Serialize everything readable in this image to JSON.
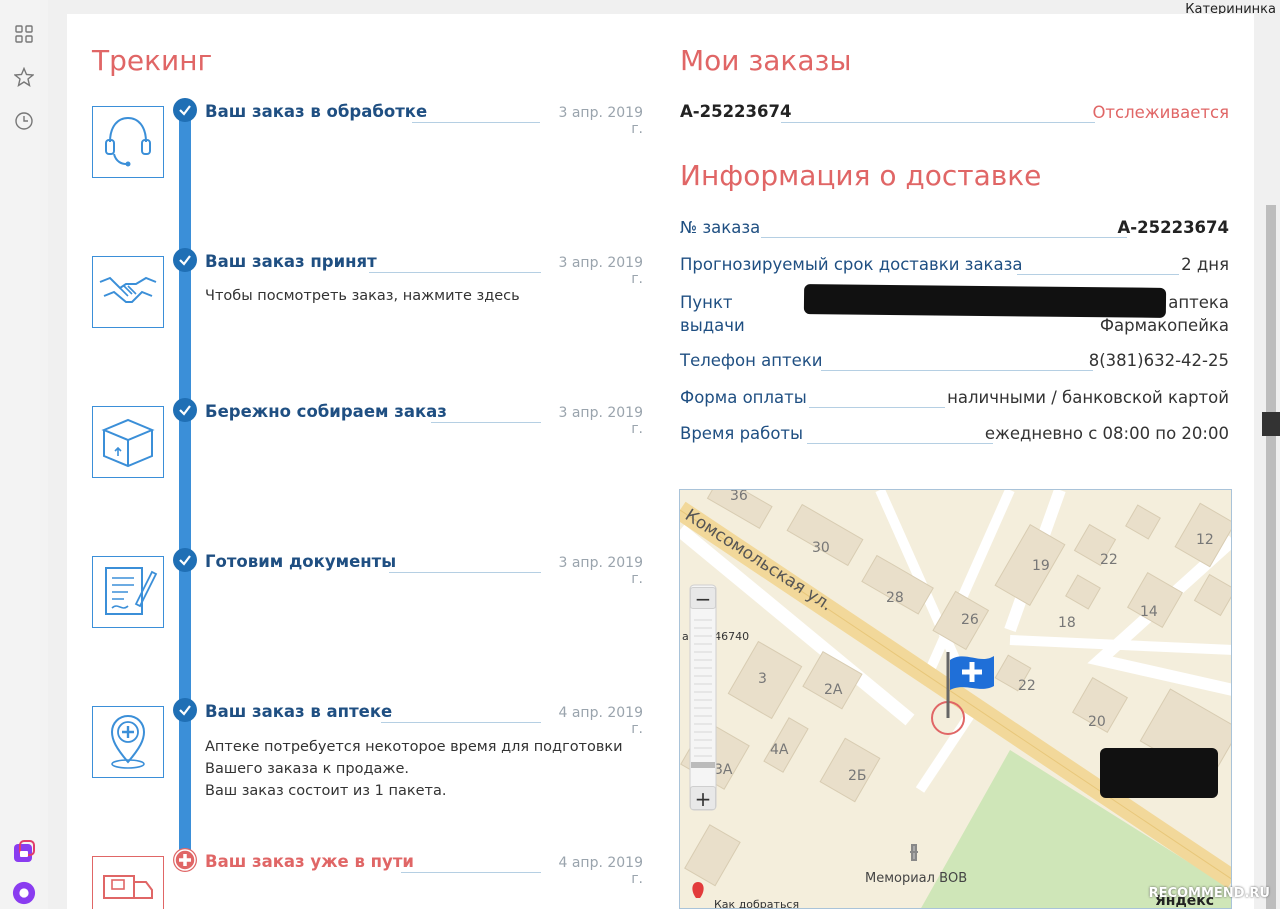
{
  "browser": {
    "user_name": "Катерининка",
    "left_icons": [
      "grid-icon",
      "star-icon",
      "clock-icon",
      "app-icon",
      "alice-icon"
    ]
  },
  "tracking": {
    "title": "Трекинг",
    "steps": [
      {
        "icon": "headset-icon",
        "status": "done",
        "title": "Ваш заказ в обработке",
        "date": "3 апр. 2019 г.",
        "desc": []
      },
      {
        "icon": "handshake-icon",
        "status": "done",
        "title": "Ваш заказ принят",
        "date": "3 апр. 2019 г.",
        "desc": [
          "Чтобы посмотреть заказ, нажмите здесь"
        ]
      },
      {
        "icon": "box-icon",
        "status": "done",
        "title": "Бережно собираем заказ",
        "date": "3 апр. 2019 г.",
        "desc": []
      },
      {
        "icon": "document-icon",
        "status": "done",
        "title": "Готовим документы",
        "date": "3 апр. 2019 г.",
        "desc": []
      },
      {
        "icon": "pharmacy-pin-icon",
        "status": "done",
        "title": "Ваш заказ в аптеке",
        "date": "4 апр. 2019 г.",
        "desc": [
          "Аптеке потребуется некоторое время для подготовки",
          "Вашего заказа к продаже.",
          "Ваш заказ состоит из 1 пакета."
        ]
      },
      {
        "icon": "truck-icon",
        "status": "current",
        "title": "Ваш заказ уже в пути",
        "date": "4 апр. 2019 г.",
        "desc": []
      }
    ]
  },
  "orders": {
    "title": "Мои заказы",
    "order_number": "А-25223674",
    "order_status": "Отслеживается"
  },
  "delivery": {
    "title": "Информация о доставке",
    "rows": [
      {
        "label": "№ заказа",
        "value": "А-25223674"
      },
      {
        "label": "Прогнозируемый срок доставки заказа",
        "value": "2 дня"
      },
      {
        "label": "Пункт выдачи",
        "value": "аптека Фармакопейка"
      },
      {
        "label": "Телефон аптеки",
        "value": "8(381)632-42-25"
      },
      {
        "label": "Форма оплаты",
        "value": "наличными / банковской картой"
      },
      {
        "label": "Время работы",
        "value": "ежедневно с 08:00 по 20:00"
      }
    ],
    "pickup_label_line1": "Пункт",
    "pickup_label_line2": "выдачи",
    "pickup_value_line1": "аптека",
    "pickup_value_line2": "Фармакопейка"
  },
  "map": {
    "street": "Комсомольская ул.",
    "buildings": [
      "36",
      "30",
      "28",
      "26",
      "19",
      "22",
      "12",
      "18",
      "14",
      "3",
      "2А",
      "22",
      "20",
      "4А",
      "2Б",
      "3А"
    ],
    "label_partial": "а № 546740",
    "landmark": "Мемориал ВОВ",
    "provider": "Яндекс",
    "zoom_in": "+",
    "zoom_out": "−"
  },
  "watermark": "RECOMMEND.RU"
}
